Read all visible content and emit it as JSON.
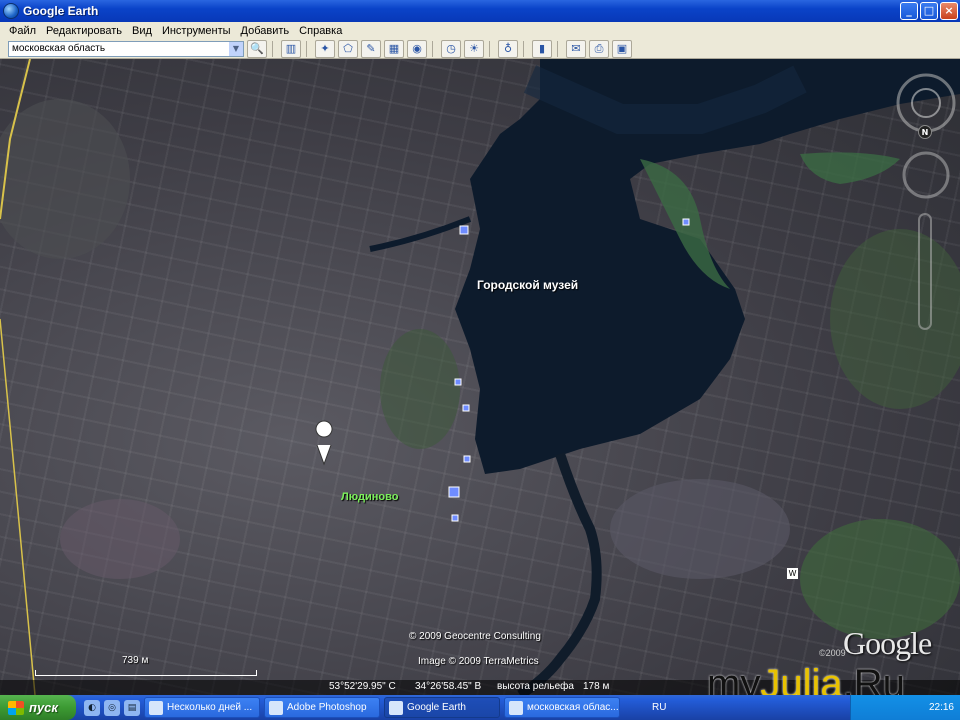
{
  "window": {
    "title": "Google Earth",
    "buttons": [
      "_",
      "□",
      "×"
    ]
  },
  "menu": [
    "Файл",
    "Редактировать",
    "Вид",
    "Инструменты",
    "Добавить",
    "Справка"
  ],
  "search": {
    "value": "московская область"
  },
  "toolbar_icons": [
    "sidebar-icon",
    "placemark-icon",
    "polygon-icon",
    "path-icon",
    "overlay-icon",
    "tour-icon",
    "history-icon",
    "sun-icon",
    "planets-icon",
    "ruler-icon",
    "email-icon",
    "print-icon",
    "maps-icon"
  ],
  "map": {
    "labels": {
      "museum": "Городской музей",
      "town": "Людиново"
    },
    "credits": {
      "line1": "© 2009 Geocentre Consulting",
      "line2": "Image © 2009 TerraMetrics"
    },
    "scale": "739 м",
    "google_logo": "Google",
    "google_year": "©2009",
    "compass": "N",
    "w_marker": "W"
  },
  "status": {
    "lat": "53°52'29.95\" С",
    "lon": "34°26'58.45\" В",
    "elevation_label": "высота рельефа",
    "elevation_value": "178 м"
  },
  "watermark": {
    "part1": "my",
    "part2": "Julia",
    "part3": ".Ru"
  },
  "taskbar": {
    "start": "пуск",
    "tasks": [
      {
        "label": "Несколько дней ..."
      },
      {
        "label": "Adobe Photoshop"
      },
      {
        "label": "Google Earth"
      },
      {
        "label": "московская облас..."
      }
    ],
    "lang": "RU",
    "clock": "22:16"
  }
}
